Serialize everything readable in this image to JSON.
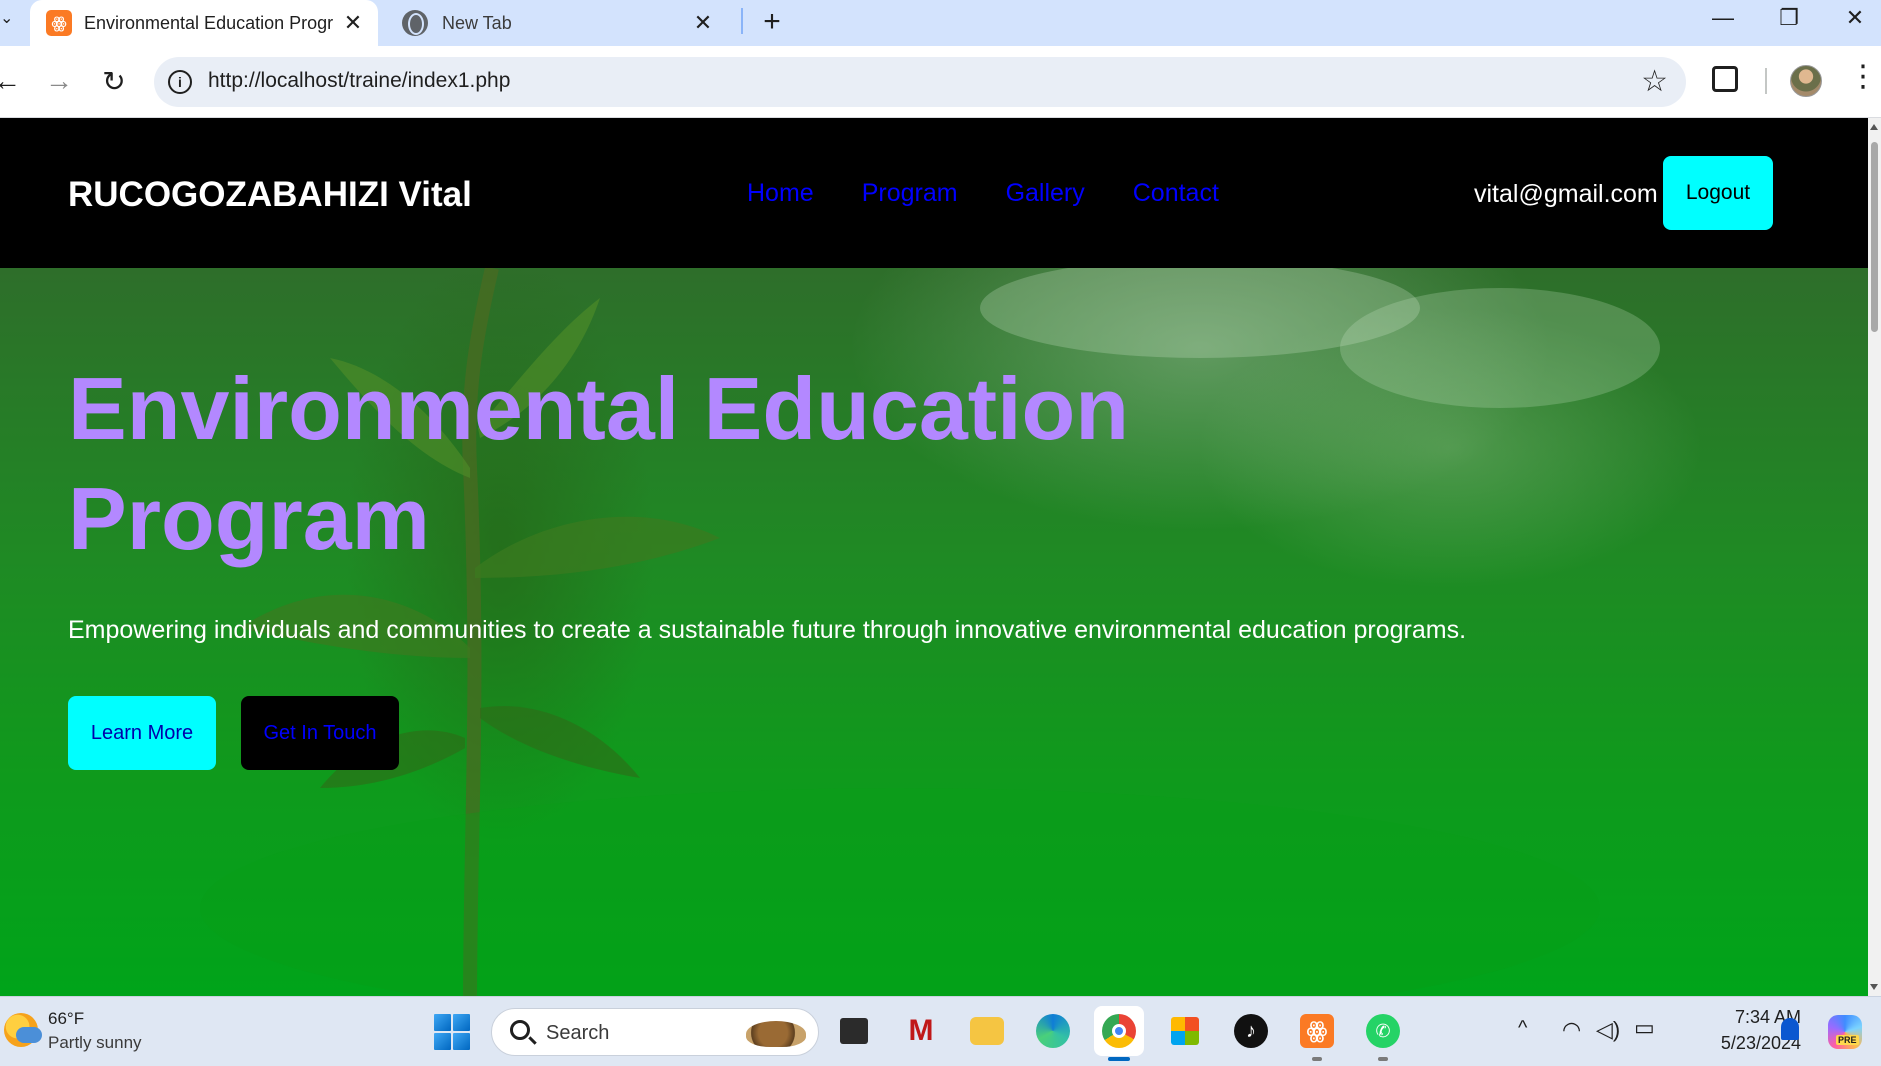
{
  "browser": {
    "tabs": [
      {
        "title": "Environmental Education Progr",
        "favicon": "xampp-icon",
        "active": true
      },
      {
        "title": "New Tab",
        "favicon": "globe-icon",
        "active": false
      }
    ],
    "url": "http://localhost/traine/index1.php"
  },
  "site": {
    "brand": "RUCOGOZABAHIZI Vital",
    "nav": [
      "Home",
      "Program",
      "Gallery",
      "Contact"
    ],
    "user_email": "vital@gmail.com",
    "logout_label": "Logout",
    "hero": {
      "title_line1": "Environmental Education",
      "title_line2": "Program",
      "subtitle": "Empowering individuals and communities to create a sustainable future through innovative environmental education programs.",
      "learn_more_label": "Learn More",
      "get_in_touch_label": "Get In Touch"
    }
  },
  "taskbar": {
    "weather_temp": "66°F",
    "weather_desc": "Partly sunny",
    "search_label": "Search",
    "apps": [
      "task-view",
      "mcafee",
      "file-explorer",
      "edge",
      "chrome",
      "microsoft-store",
      "tiktok",
      "xampp",
      "whatsapp"
    ],
    "time": "7:34 AM",
    "date": "5/23/2024"
  },
  "colors": {
    "header_bg": "#000000",
    "nav_link": "#0000ff",
    "hero_title": "#b388ff",
    "accent_button": "#00ffff"
  }
}
